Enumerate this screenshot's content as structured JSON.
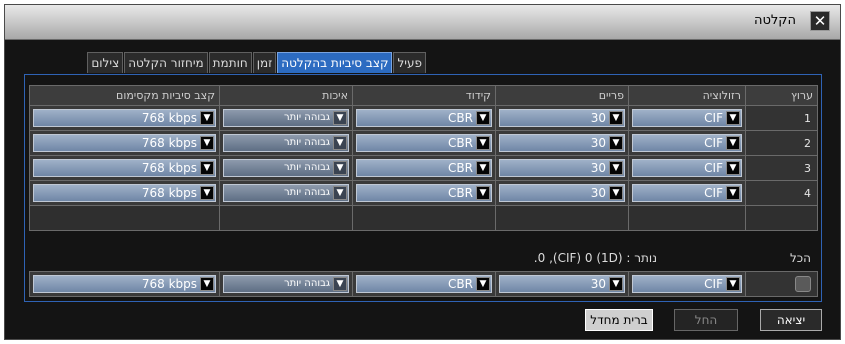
{
  "window": {
    "title": "הקלטה",
    "close_glyph": "✕"
  },
  "tabs": [
    "פעיל",
    "קצב סיביות בהקלטה",
    "זמן",
    "חותמת",
    "מיחזור הקלטה",
    "צילום"
  ],
  "active_tab_index": 1,
  "table": {
    "headers": [
      "ערוץ",
      "רזולוציה",
      "פריים",
      "קידוד",
      "איכות",
      "קצב סיביות מקסימום"
    ],
    "rows": [
      {
        "channel": "1",
        "resolution": "CIF",
        "fps": "30",
        "encoding": "CBR",
        "quality": "גבוהה יותר",
        "bitrate": "768 kbps"
      },
      {
        "channel": "2",
        "resolution": "CIF",
        "fps": "30",
        "encoding": "CBR",
        "quality": "גבוהה יותר",
        "bitrate": "768 kbps"
      },
      {
        "channel": "3",
        "resolution": "CIF",
        "fps": "30",
        "encoding": "CBR",
        "quality": "גבוהה יותר",
        "bitrate": "768 kbps"
      },
      {
        "channel": "4",
        "resolution": "CIF",
        "fps": "30",
        "encoding": "CBR",
        "quality": "גבוהה יותר",
        "bitrate": "768 kbps"
      }
    ]
  },
  "all": {
    "label": "הכל",
    "remaining": "נותר : (1D) 0 ,(CIF) 0.",
    "resolution": "CIF",
    "fps": "30",
    "encoding": "CBR",
    "quality": "גבוהה יותר",
    "bitrate": "768 kbps"
  },
  "buttons": {
    "exit": "יציאה",
    "apply": "החל",
    "default": "ברית מחדל"
  },
  "colors": {
    "active_tab": "#2c6bc1",
    "panel_border": "#2f63b5",
    "dropdown": "#8fa3bd"
  }
}
